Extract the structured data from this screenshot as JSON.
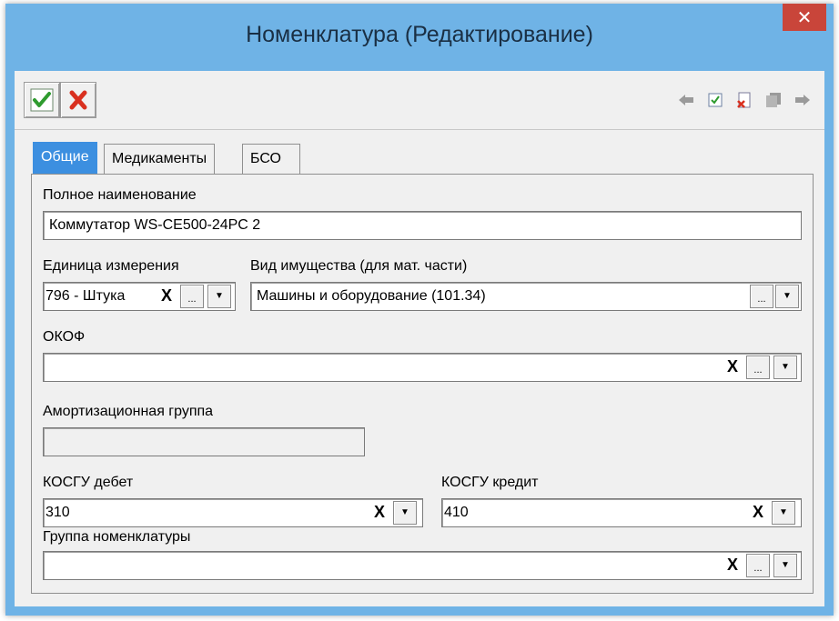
{
  "window": {
    "title": "Номенклатура (Редактирование)",
    "close_glyph": "✕"
  },
  "toolbar": {
    "ok_icon": "checkmark-icon",
    "cancel_icon": "red-x-icon",
    "nav_icons": [
      "arrow-left-icon",
      "check-document-icon",
      "delete-document-icon",
      "copy-document-icon",
      "arrow-right-icon"
    ]
  },
  "tabs": [
    {
      "label": "Общие",
      "active": true
    },
    {
      "label": "Медикаменты",
      "active": false
    },
    {
      "label": "БСО",
      "active": false
    }
  ],
  "form": {
    "full_name": {
      "label": "Полное наименование",
      "value": "Коммутатор WS-CE500-24PC 2"
    },
    "unit": {
      "label": "Единица измерения",
      "value": "796 - Штука"
    },
    "property_type": {
      "label": "Вид имущества (для мат. части)",
      "value": "Машины и оборудование (101.34)"
    },
    "okof": {
      "label": "ОКОФ",
      "value": ""
    },
    "depreciation_group": {
      "label": "Амортизационная группа",
      "value": ""
    },
    "kosgu_debit": {
      "label": "КОСГУ дебет",
      "value": "310"
    },
    "kosgu_credit": {
      "label": "КОСГУ кредит",
      "value": "410"
    },
    "nomenclature_group": {
      "label": "Группа номенклатуры",
      "value": ""
    }
  },
  "glyphs": {
    "clear": "X",
    "ellipsis": "...",
    "dropdown": "▼"
  },
  "colors": {
    "title_bar": "#6fb3e6",
    "close_button": "#c9453a",
    "active_tab": "#3c8fe0"
  }
}
